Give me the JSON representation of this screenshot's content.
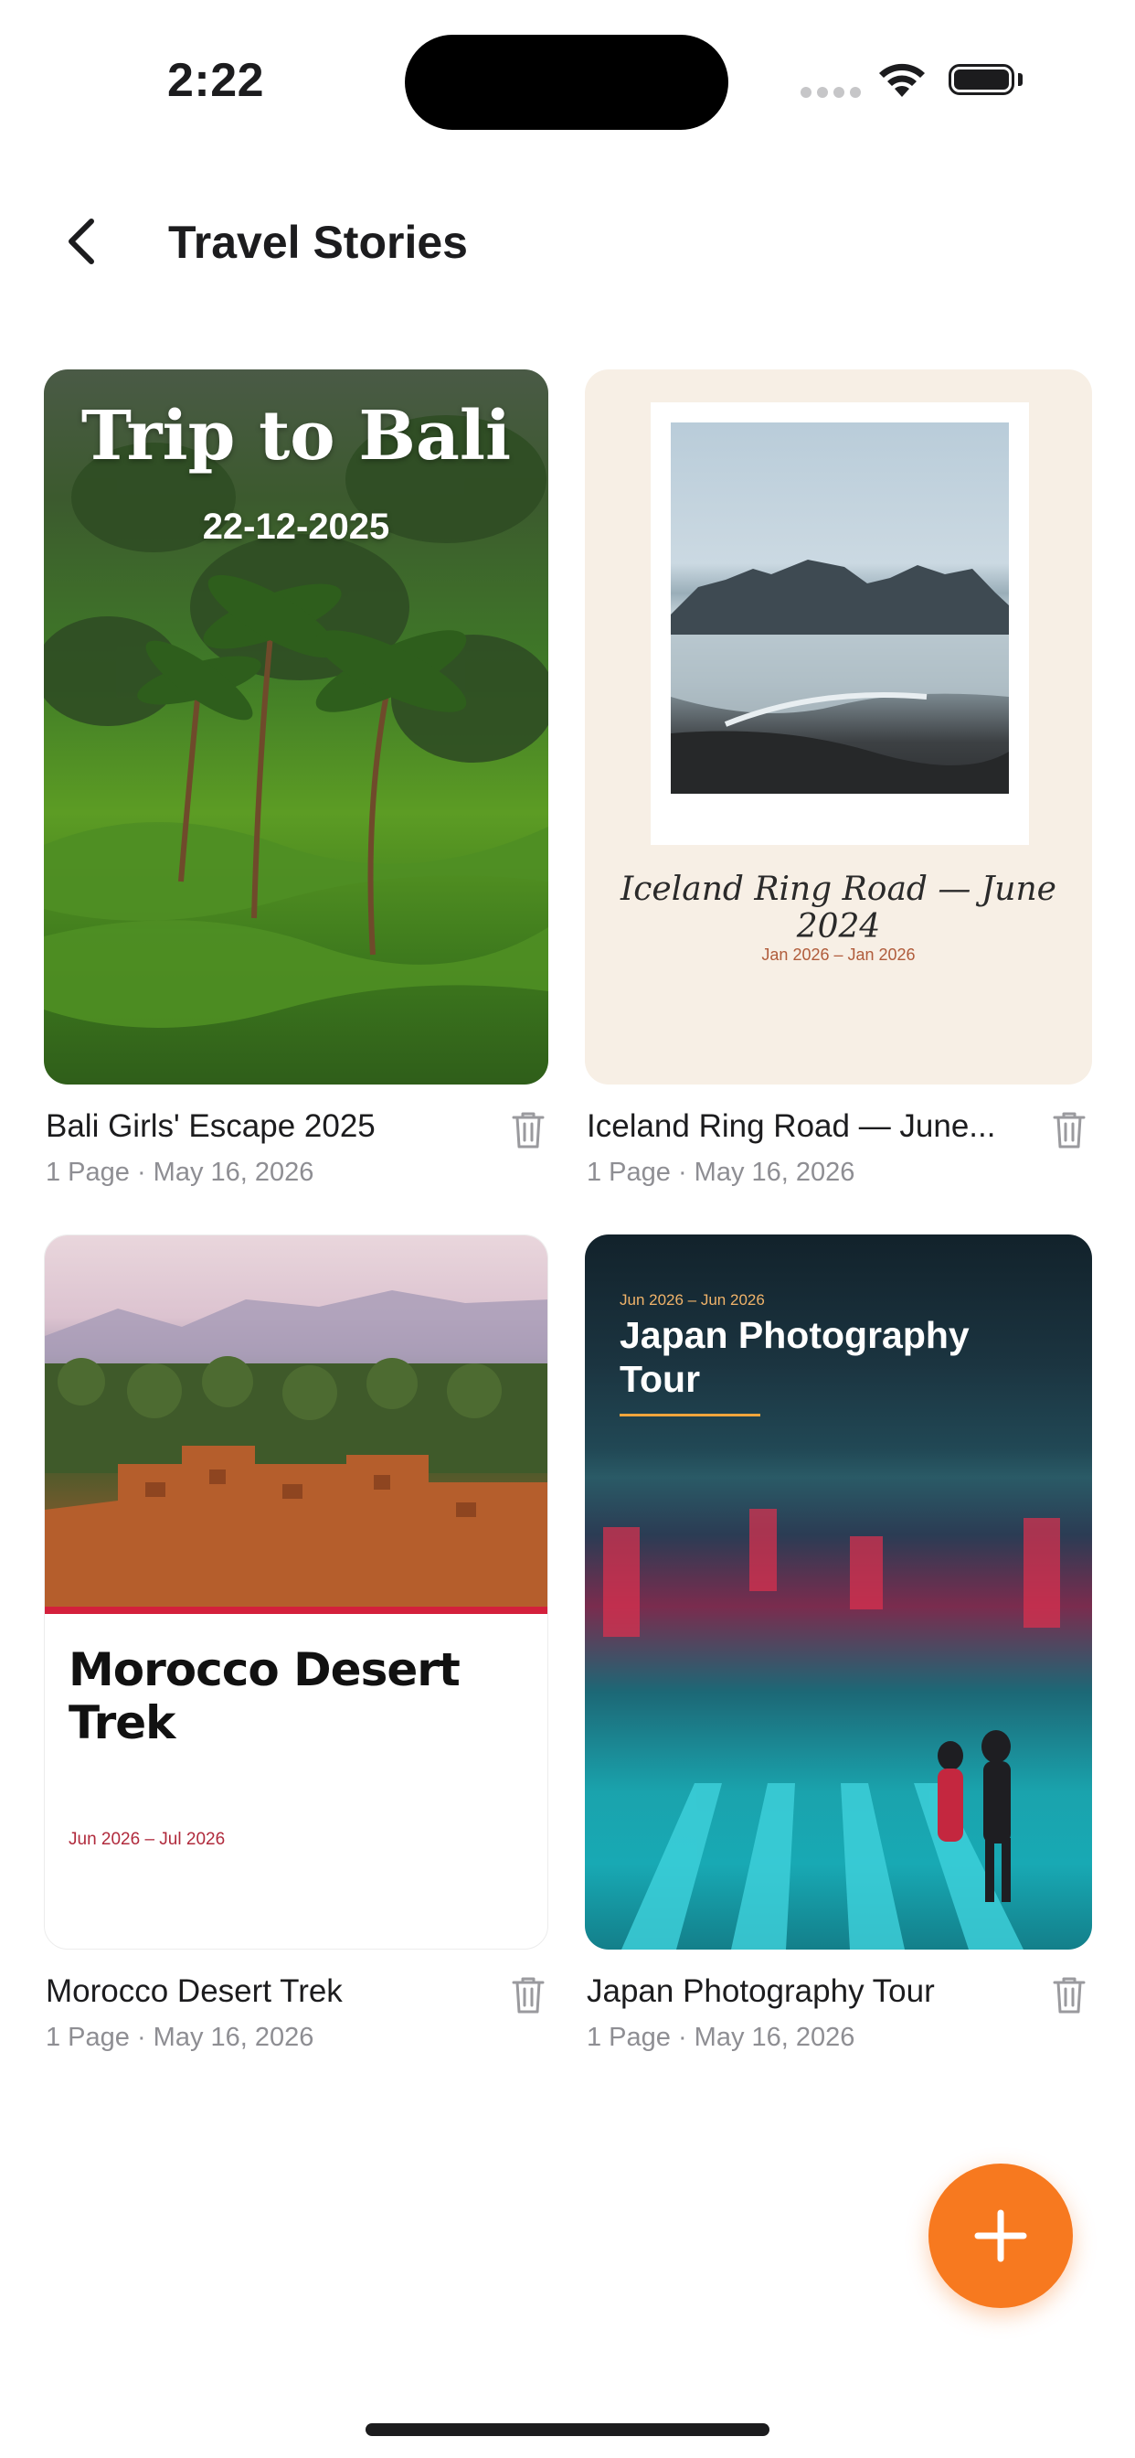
{
  "status_bar": {
    "time": "2:22"
  },
  "header": {
    "title": "Travel Stories"
  },
  "stories": [
    {
      "name": "Bali Girls' Escape 2025",
      "meta": "1 Page · May 16, 2026",
      "cover": {
        "title": "Trip to Bali",
        "date": "22-12-2025"
      }
    },
    {
      "name": "Iceland Ring Road — June...",
      "meta": "1 Page · May 16, 2026",
      "cover": {
        "title": "Iceland Ring Road — June 2024",
        "date": "Jan 2026 – Jan 2026"
      }
    },
    {
      "name": "Morocco Desert Trek",
      "meta": "1 Page · May 16, 2026",
      "cover": {
        "title": "Morocco Desert Trek",
        "date": "Jun 2026 – Jul 2026"
      }
    },
    {
      "name": "Japan Photography Tour",
      "meta": "1 Page · May 16, 2026",
      "cover": {
        "title": "Japan Photography Tour",
        "date": "Jun 2026 – Jun 2026"
      }
    }
  ],
  "icons": {
    "back": "chevron-left-icon",
    "delete": "trash-icon",
    "add": "plus-icon"
  },
  "colors": {
    "accent": "#f7791f",
    "morocco_accent": "#d4203c",
    "japan_accent": "#f0a53c",
    "iceland_background": "#f7efe5",
    "secondary_text": "#8e8e93"
  }
}
